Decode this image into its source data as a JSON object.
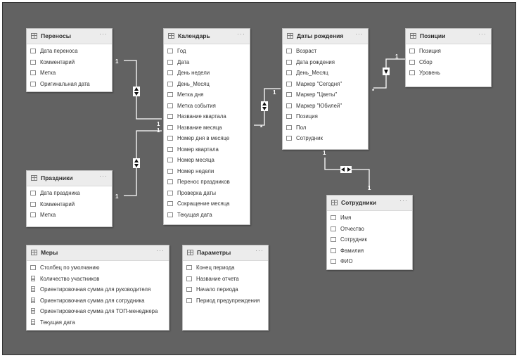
{
  "tables": {
    "perenosy": {
      "title": "Переносы",
      "fields": [
        "Дата переноса",
        "Комментарий",
        "Метка",
        "Оригинальная дата"
      ]
    },
    "kalendar": {
      "title": "Календарь",
      "fields": [
        "Год",
        "Дата",
        "День недели",
        "День_Месяц",
        "Метка дня",
        "Метка события",
        "Название квартала",
        "Название месяца",
        "Номер дня в месяце",
        "Номер квартала",
        "Номер месяца",
        "Номер недели",
        "Перенос праздников",
        "Проверка даты",
        "Сокращение месяца",
        "Текущая дата"
      ]
    },
    "daty_rozhdeniya": {
      "title": "Даты рождения",
      "fields": [
        "Возраст",
        "Дата рождения",
        "День_Месяц",
        "Маркер \"Сегодня\"",
        "Маркер \"Цветы\"",
        "Маркер \"Юбилей\"",
        "Позиция",
        "Пол",
        "Сотрудник"
      ]
    },
    "pozicii": {
      "title": "Позиции",
      "fields": [
        "Позиция",
        "Сбор",
        "Уровень"
      ]
    },
    "prazdniki": {
      "title": "Праздники",
      "fields": [
        "Дата праздника",
        "Комментарий",
        "Метка"
      ]
    },
    "sotrudniki": {
      "title": "Сотрудники",
      "fields": [
        "Имя",
        "Отчество",
        "Сотрудник",
        "Фамилия",
        "ФИО"
      ]
    },
    "mery": {
      "title": "Меры",
      "fields": [
        "Столбец по умолчанию",
        "Количество участников",
        "Ориентировочная сумма для руководителя",
        "Ориентировочная сумма для сотрудника",
        "Ориентировочная сумма для ТОП-менеджера",
        "Текущая дата"
      ],
      "field_icons": [
        "table",
        "calc",
        "calc",
        "calc",
        "calc",
        "calc"
      ]
    },
    "parametry": {
      "title": "Параметры",
      "fields": [
        "Конец периода",
        "Название отчета",
        "Начало периода",
        "Период предупреждения"
      ]
    }
  },
  "more_glyph": "···",
  "relationships": [
    {
      "from": "perenosy",
      "to": "kalendar",
      "one": "1",
      "many": "1",
      "direction": "both"
    },
    {
      "from": "prazdniki",
      "to": "kalendar",
      "one": "1",
      "many": "1",
      "direction": "both"
    },
    {
      "from": "kalendar",
      "to": "daty_rozhdeniya",
      "one": "1",
      "many": "*",
      "direction": "both"
    },
    {
      "from": "daty_rozhdeniya",
      "to": "pozicii",
      "one": "1",
      "many": "*",
      "direction": "single"
    },
    {
      "from": "daty_rozhdeniya",
      "to": "sotrudniki",
      "one": "1",
      "many": "1",
      "direction": "both"
    }
  ],
  "colors": {
    "canvas": "#626262",
    "card_header": "#ececec",
    "card_body": "#ffffff",
    "line": "#ffffff"
  }
}
